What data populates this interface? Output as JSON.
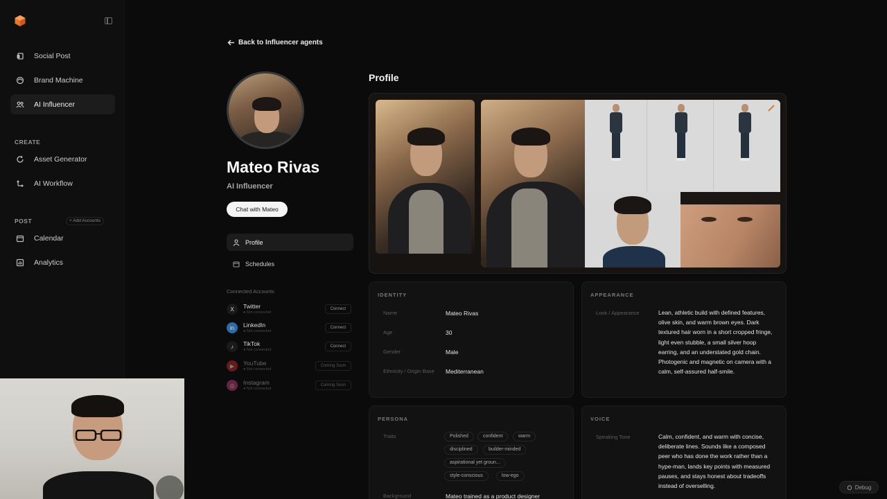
{
  "sidebar": {
    "nav": [
      {
        "label": "Social Post",
        "icon": "social-post-icon"
      },
      {
        "label": "Brand Machine",
        "icon": "brand-machine-icon"
      },
      {
        "label": "AI Influencer",
        "icon": "users-icon",
        "active": true
      }
    ],
    "create_label": "CREATE",
    "create": [
      {
        "label": "Asset Generator",
        "icon": "refresh-icon"
      },
      {
        "label": "AI Workflow",
        "icon": "workflow-icon"
      }
    ],
    "post_label": "POST",
    "add_accounts": "+ Add Accounts",
    "post": [
      {
        "label": "Calendar",
        "icon": "calendar-icon"
      },
      {
        "label": "Analytics",
        "icon": "analytics-icon"
      }
    ]
  },
  "header": {
    "back_label": "Back to Influencer agents"
  },
  "influencer": {
    "name": "Mateo Rivas",
    "role": "AI Influencer",
    "chat_label": "Chat with Mateo"
  },
  "tabs": [
    {
      "label": "Profile",
      "icon": "person-icon",
      "active": true
    },
    {
      "label": "Schedules",
      "icon": "calendar-icon"
    }
  ],
  "connected": {
    "title": "Connected Accounts",
    "accounts": [
      {
        "name": "Twitter",
        "status": "● Not connected",
        "action": "Connect",
        "color": "#1a1a1a",
        "glyph": "X"
      },
      {
        "name": "LinkedIn",
        "status": "● Not connected",
        "action": "Connect",
        "color": "#2d6aa6",
        "glyph": "in"
      },
      {
        "name": "TikTok",
        "status": "● Not connected",
        "action": "Connect",
        "color": "#1a1a1a",
        "glyph": "♪"
      },
      {
        "name": "YouTube",
        "status": "● Not connected",
        "action": "Coming Soon",
        "color": "#b2272b",
        "glyph": "▶"
      },
      {
        "name": "Instagram",
        "status": "● Not connected",
        "action": "Coming Soon",
        "color": "#b03a6a",
        "glyph": "◎"
      }
    ]
  },
  "profile_heading": "Profile",
  "identity": {
    "title": "IDENTITY",
    "rows": [
      {
        "key": "Name",
        "value": "Mateo Rivas"
      },
      {
        "key": "Age",
        "value": "30"
      },
      {
        "key": "Gender",
        "value": "Male"
      },
      {
        "key": "Ethnicity / Origin Base",
        "value": "Mediterranean"
      }
    ]
  },
  "appearance": {
    "title": "APPEARANCE",
    "key": "Look / Appearance",
    "value": "Lean, athletic build with defined features, olive skin, and warm brown eyes. Dark textured hair worn in a short cropped fringe, light even stubble, a small silver hoop earring, and an understated gold chain. Photogenic and magnetic on camera with a calm, self-assured half-smile."
  },
  "persona": {
    "title": "PERSONA",
    "traits_key": "Traits",
    "traits": [
      "Polished",
      "confident",
      "warm",
      "disciplined",
      "builder-minded",
      "aspirational yet groun...",
      "style-conscious",
      "low-ego"
    ],
    "background_key": "Background",
    "background_value": "Mateo trained as a product designer"
  },
  "voice": {
    "title": "VOICE",
    "key": "Speaking Tone",
    "value": "Calm, confident, and warm with concise, deliberate lines. Sounds like a composed peer who has done the work rather than a hype-man, lands key points with measured pauses, and stays honest about tradeoffs instead of overselling."
  },
  "debug_label": "Debug",
  "colors": {
    "accent": "#e8762c",
    "background": "#0b0b0b",
    "panel": "#121212"
  }
}
